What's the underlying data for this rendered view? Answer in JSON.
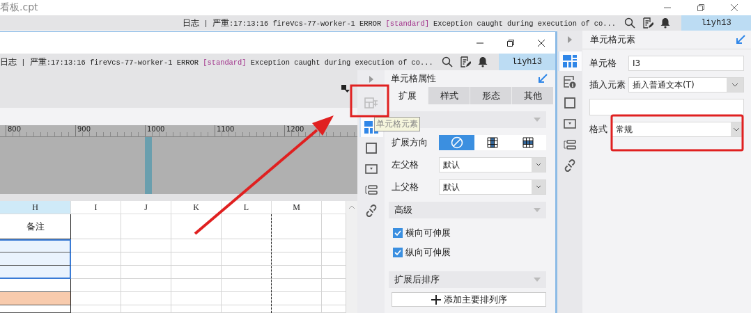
{
  "back_window": {
    "title": "看板.cpt",
    "log": {
      "label": "日志",
      "separator": "|",
      "level": "严重",
      "message": ":17:13:16 fireVcs-77-worker-1 ERROR",
      "tag": "[standard]",
      "detail": "Exception caught during execution of co..."
    },
    "user": "liyh13",
    "side_tabs": [
      {
        "selected": true
      },
      {
        "selected": false
      },
      {
        "selected": false
      },
      {
        "selected": false
      },
      {
        "selected": false
      },
      {
        "selected": false
      }
    ],
    "cell_element_panel": {
      "title": "单元格元素",
      "cell_label": "单元格",
      "cell_value": "I3",
      "insert_label": "插入元素",
      "insert_value": "插入普通文本(T)",
      "format_label": "格式",
      "format_value": "常规"
    }
  },
  "front_window": {
    "log": {
      "label": "日志",
      "separator": "|",
      "level": "严重",
      "message": ":17:13:16 fireVcs-77-worker-1 ERROR",
      "tag": "[standard]",
      "detail": "Exception caught during execution of co..."
    },
    "user": "liyh13",
    "ruler": [
      "800",
      "900",
      "1000",
      "1100",
      "1200"
    ],
    "columns": [
      {
        "label": "H",
        "selected": true
      },
      {
        "label": "I",
        "selected": false
      },
      {
        "label": "J",
        "selected": false
      },
      {
        "label": "K",
        "selected": false
      },
      {
        "label": "L",
        "selected": false
      },
      {
        "label": "M",
        "selected": false
      }
    ],
    "rows": [
      {
        "h_cell": "备注",
        "selected": false
      },
      {
        "selected": true
      },
      {
        "selected": true
      },
      {
        "selected": true
      },
      {
        "selected": false
      },
      {
        "selected": false,
        "color": "#f8cbad"
      },
      {
        "selected": false
      }
    ],
    "side_tabs": [
      {
        "selected": false,
        "disabled": true
      },
      {
        "selected": true,
        "disabled": false
      },
      {
        "selected": false,
        "disabled": false
      },
      {
        "selected": false,
        "disabled": false
      },
      {
        "selected": false,
        "disabled": false
      },
      {
        "selected": false,
        "disabled": false
      }
    ],
    "tooltip": "单元格元素",
    "cell_attributes_panel": {
      "title": "单元格属性",
      "tabs": [
        {
          "label": "扩展",
          "selected": true
        },
        {
          "label": "样式",
          "selected": false
        },
        {
          "label": "形态",
          "selected": false
        },
        {
          "label": "其他",
          "selected": false
        }
      ],
      "expand_direction": {
        "label": "扩展方向",
        "options": [
          {
            "kind": "none",
            "selected": true
          },
          {
            "kind": "vertical",
            "selected": false
          },
          {
            "kind": "horizontal",
            "selected": false
          }
        ]
      },
      "left_parent": {
        "label": "左父格",
        "value": "默认"
      },
      "top_parent": {
        "label": "上父格",
        "value": "默认"
      },
      "advanced": {
        "title": "高级",
        "checkboxes": [
          {
            "label": "横向可伸展",
            "checked": true
          },
          {
            "label": "纵向可伸展",
            "checked": true
          }
        ]
      },
      "sort": {
        "title": "扩展后排序",
        "button": "添加主要排列序"
      }
    }
  }
}
